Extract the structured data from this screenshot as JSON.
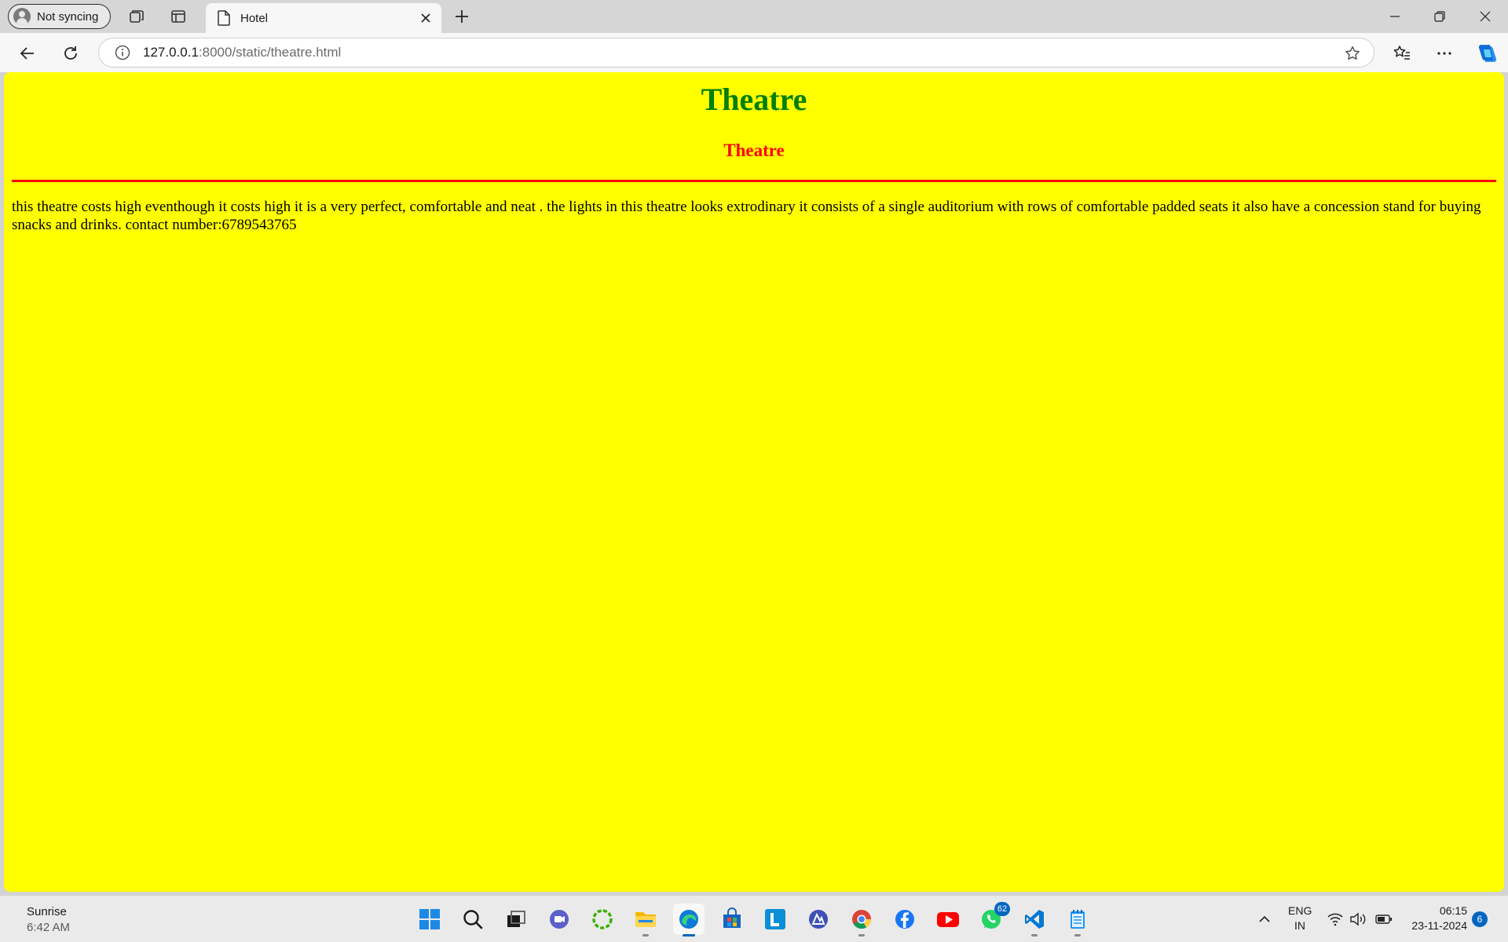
{
  "browser": {
    "profile_label": "Not syncing",
    "tab_title": "Hotel",
    "url_host": "127.0.0.1",
    "url_rest": ":8000/static/theatre.html"
  },
  "page": {
    "heading": "Theatre",
    "subheading": "Theatre",
    "paragraph": "this theatre costs high eventhough it costs high it is a very perfect, comfortable and neat . the lights in this theatre looks extrodinary it consists of a single auditorium with rows of comfortable padded seats it also have a concession stand for buying snacks and drinks. contact number:6789543765",
    "background_color": "#ffff00",
    "heading_color": "#008000",
    "subheading_color": "#ff0000"
  },
  "taskbar": {
    "weather_title": "Sunrise",
    "weather_time": "6:42 AM",
    "whatsapp_badge": "62",
    "lang_line1": "ENG",
    "lang_line2": "IN",
    "clock_time": "06:15",
    "clock_date": "23-11-2024",
    "notification_count": "6",
    "apps": [
      "start-icon",
      "search-icon",
      "task-view-icon",
      "chat-icon",
      "circle-app-icon",
      "file-explorer-icon",
      "edge-icon",
      "store-icon",
      "l-app-icon",
      "delta-app-icon",
      "chrome-icon",
      "facebook-icon",
      "youtube-icon",
      "whatsapp-icon",
      "vscode-icon",
      "notepad-icon"
    ]
  }
}
